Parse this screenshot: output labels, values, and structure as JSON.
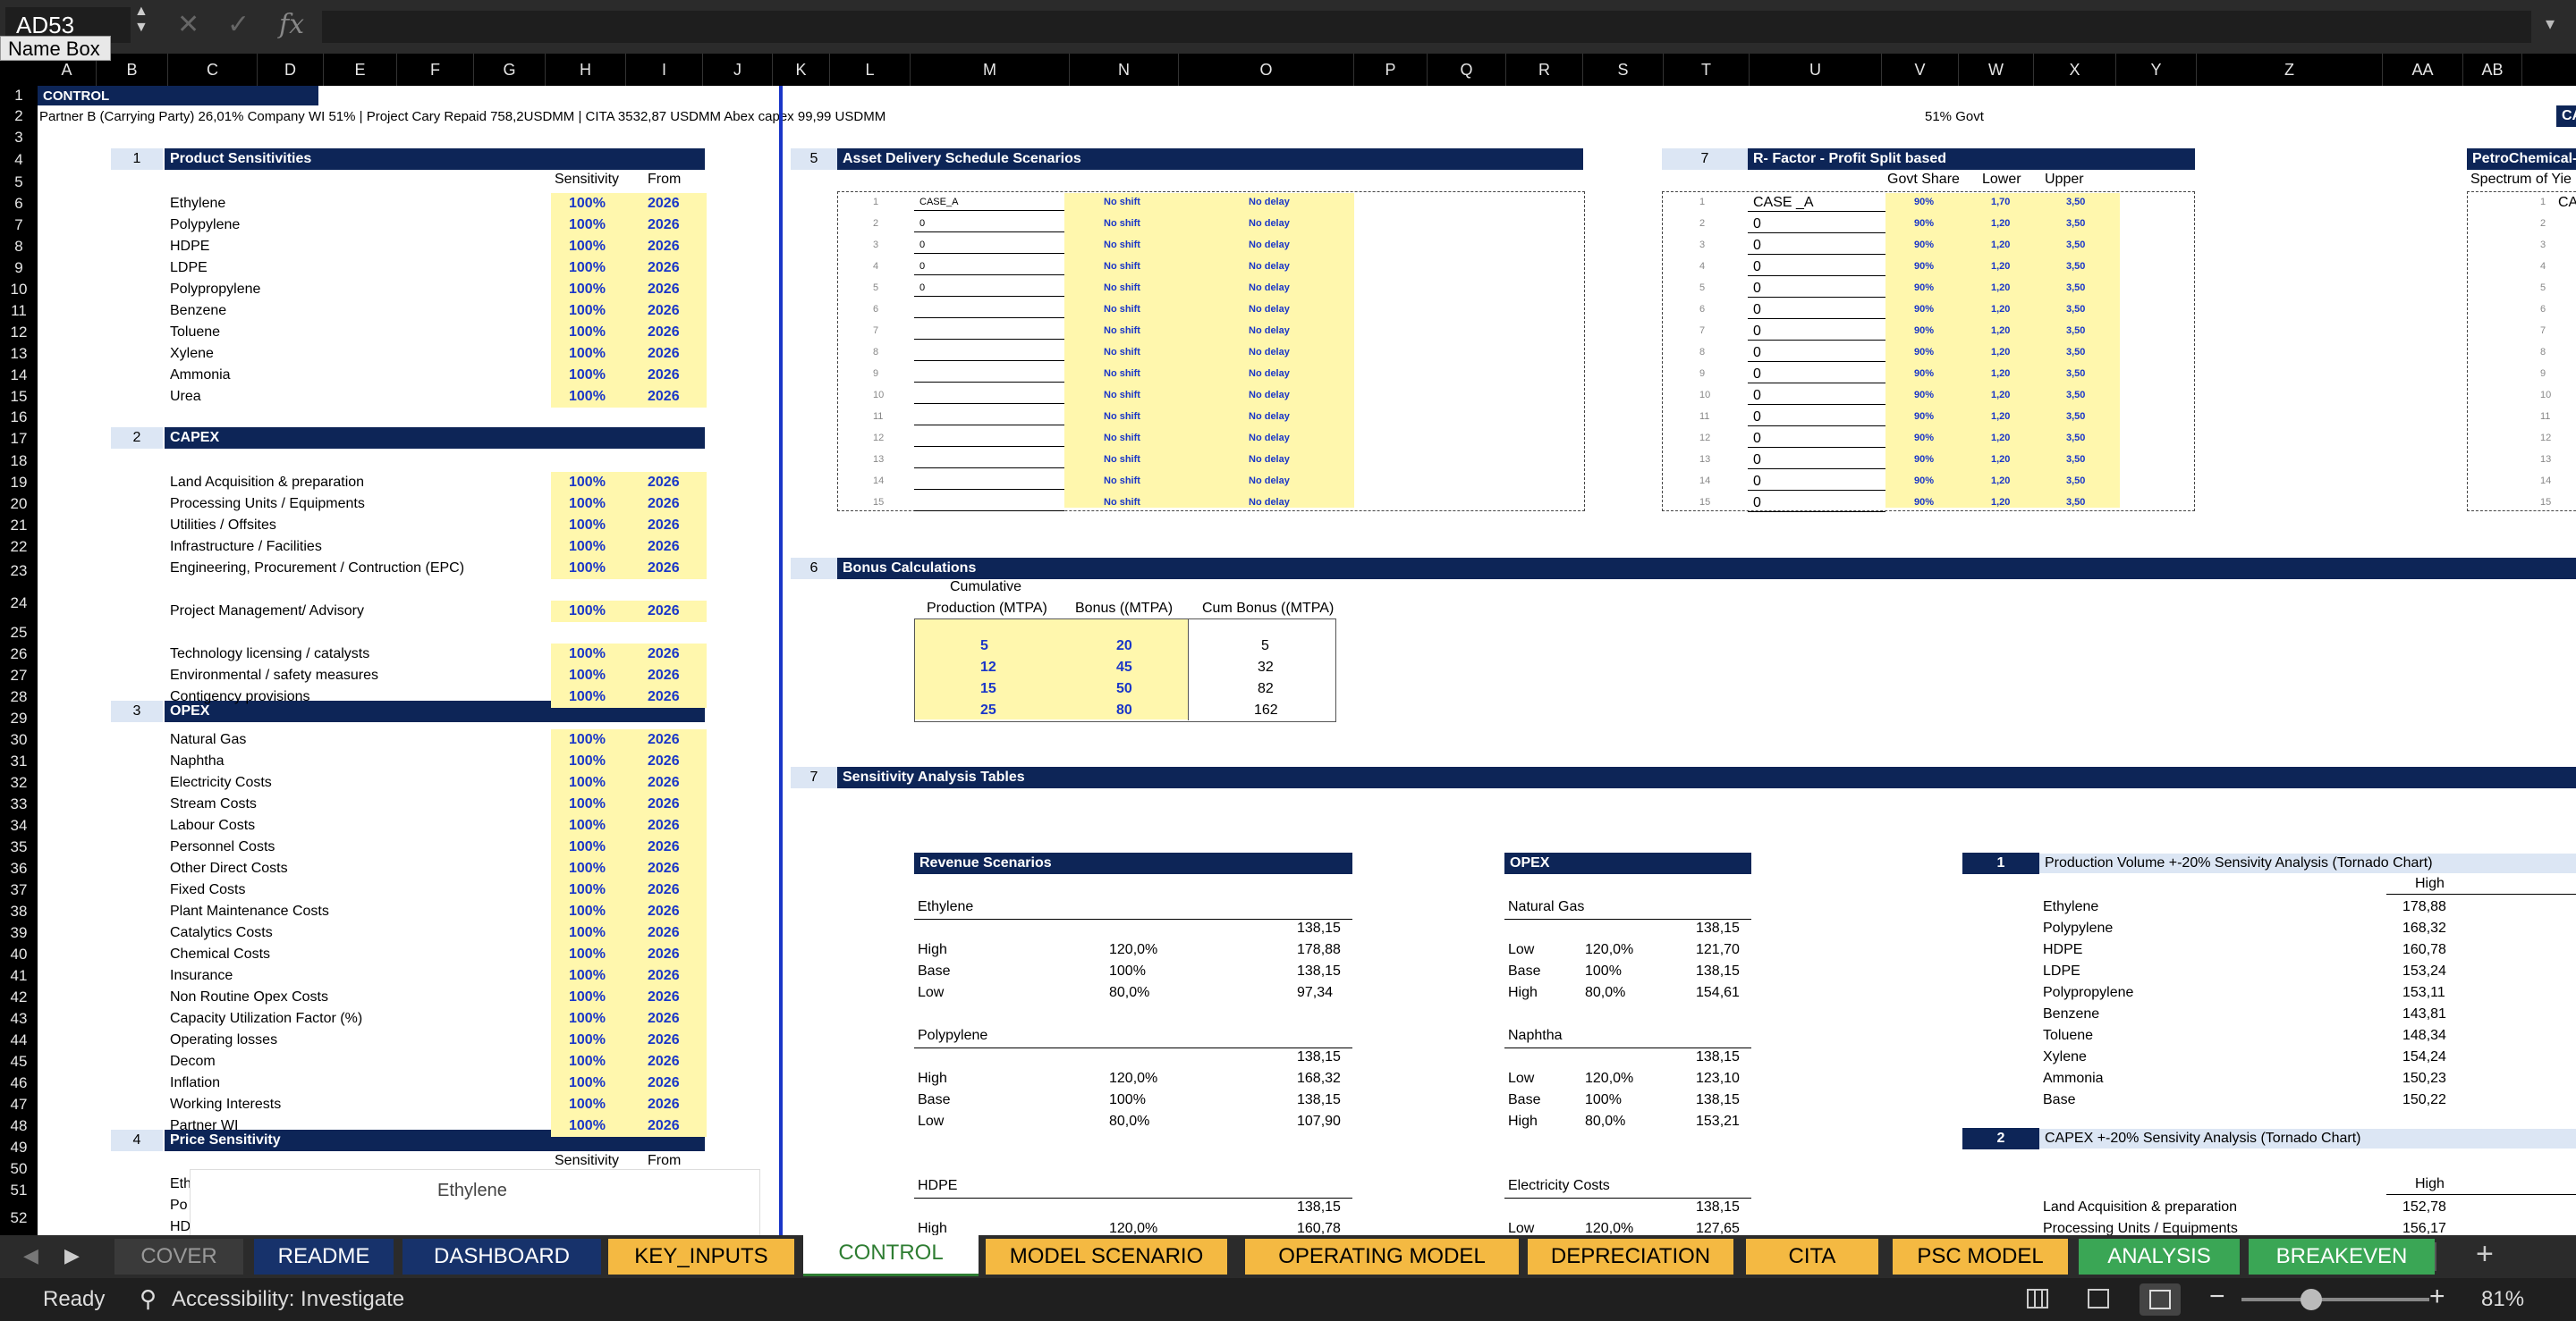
{
  "formula_bar": {
    "name_box": "AD53",
    "name_box_tooltip": "Name Box",
    "cancel_icon": "✕",
    "enter_icon": "✓",
    "fx": "fx"
  },
  "columns": [
    "A",
    "B",
    "C",
    "D",
    "E",
    "F",
    "G",
    "H",
    "I",
    "J",
    "K",
    "L",
    "M",
    "N",
    "O",
    "P",
    "Q",
    "R",
    "S",
    "T",
    "U",
    "V",
    "W",
    "X",
    "Y",
    "Z",
    "AA",
    "AB"
  ],
  "rows": [
    "1",
    "2",
    "3",
    "4",
    "5",
    "6",
    "7",
    "8",
    "9",
    "10",
    "11",
    "12",
    "13",
    "14",
    "15",
    "16",
    "17",
    "18",
    "19",
    "20",
    "21",
    "22",
    "23",
    "24",
    "25",
    "26",
    "27",
    "28",
    "29",
    "30",
    "31",
    "32",
    "33",
    "34",
    "35",
    "36",
    "37",
    "38",
    "39",
    "40",
    "41",
    "42",
    "43",
    "44",
    "45",
    "46",
    "47",
    "48",
    "49",
    "50",
    "51",
    "52"
  ],
  "sheet": {
    "control_title": "CONTROL",
    "row2_text": "Partner B (Carrying Party) 26,01% Company WI 51% |  Project Cary Repaid  758,2USDMM  |  CITA 3532,87  USDMM Abex capex 99,99  USDMM",
    "row2_right": "51%  Govt",
    "ca_fragment": "CA",
    "sections": {
      "s1": {
        "num": "1",
        "title": "Product Sensitivities",
        "col1": "Sensitivity",
        "col2": "From"
      },
      "s2": {
        "num": "2",
        "title": "CAPEX"
      },
      "s3": {
        "num": "3",
        "title": "OPEX"
      },
      "s4": {
        "num": "4",
        "title": "Price Sensitivity",
        "col1": "Sensitivity",
        "col2": "From"
      },
      "s5": {
        "num": "5",
        "title": "Asset Delivery Schedule  Scenarios"
      },
      "s6": {
        "num": "6",
        "title": "Bonus Calculations"
      },
      "s7a": {
        "num": "7",
        "title": "R- Factor - Profit Split based"
      },
      "s7b": {
        "num": "7",
        "title": "Sensitivity Analysis Tables"
      },
      "petro": {
        "title": "PetroChemical-",
        "sub": "Spectrum of Yie"
      }
    },
    "products": [
      "Ethylene",
      "Polypylene",
      "HDPE",
      "LDPE",
      "Polypropylene",
      "Benzene",
      "Toluene",
      "Xylene",
      "Ammonia",
      "Urea"
    ],
    "capex": [
      "Land Acquisition & preparation",
      "Processing Units /  Equipments",
      "Utilities  /  Offsites",
      "Infrastructure /  Facilities",
      "Engineering, Procurement / Contruction (EPC)",
      "Project Management/ Advisory",
      "Technology licensing  / catalysts",
      "Environmental / safety measures",
      "Contigency provisions"
    ],
    "opex": [
      "Natural Gas",
      "Naphtha",
      "Electricity Costs",
      "Stream Costs",
      "Labour Costs",
      "Personnel Costs",
      "Other Direct Costs",
      "Fixed Costs",
      "Plant Maintenance Costs",
      "Catalytics Costs",
      "Chemical Costs",
      "Insurance",
      "Non Routine Opex Costs",
      "Capacity Utilization Factor (%)",
      "Operating losses",
      "Decom",
      "Inflation",
      "Working Interests",
      "Partner WI"
    ],
    "sens_value": "100%",
    "from_value": "2026",
    "price_rows": [
      "Eth",
      "Po",
      "HD"
    ],
    "chart_stub": "Ethylene",
    "asset": {
      "case": "CASE_A",
      "case_rows": [
        "0",
        "0",
        "0",
        "0"
      ],
      "shift": "No shift",
      "delay": "No delay",
      "count": 15
    },
    "rfactor": {
      "headers": [
        "Govt Share",
        "Lower",
        "Upper"
      ],
      "case": "CASE _A",
      "zero": "0",
      "govt": "90%",
      "lower_first": "1,70",
      "lower": "1,20",
      "upper": "3,50"
    },
    "bonus": {
      "headers": [
        "Cumulative",
        "Production (MTPA)",
        "Bonus ((MTPA)",
        "Cum Bonus ((MTPA)"
      ],
      "rows": [
        [
          "5",
          "20",
          "5"
        ],
        [
          "12",
          "45",
          "32"
        ],
        [
          "15",
          "50",
          "82"
        ],
        [
          "25",
          "80",
          "162"
        ]
      ]
    },
    "revenue": {
      "title": "Revenue Scenarios",
      "groups": [
        {
          "name": "Ethylene",
          "top": "138,15",
          "rows": [
            [
              "High",
              "120,0%",
              "178,88"
            ],
            [
              "Base",
              "100%",
              "138,15"
            ],
            [
              "Low",
              "80,0%",
              "97,34"
            ]
          ]
        },
        {
          "name": "Polypylene",
          "top": "138,15",
          "rows": [
            [
              "High",
              "120,0%",
              "168,32"
            ],
            [
              "Base",
              "100%",
              "138,15"
            ],
            [
              "Low",
              "80,0%",
              "107,90"
            ]
          ]
        },
        {
          "name": "HDPE",
          "top": "138,15",
          "rows": [
            [
              "High",
              "120,0%",
              "160,78"
            ]
          ]
        }
      ]
    },
    "opex_table": {
      "title": "OPEX",
      "groups": [
        {
          "name": "Natural Gas",
          "top": "138,15",
          "rows": [
            [
              "Low",
              "120,0%",
              "121,70"
            ],
            [
              "Base",
              "100%",
              "138,15"
            ],
            [
              "High",
              "80,0%",
              "154,61"
            ]
          ]
        },
        {
          "name": "Naphtha",
          "top": "138,15",
          "rows": [
            [
              "Low",
              "120,0%",
              "123,10"
            ],
            [
              "Base",
              "100%",
              "138,15"
            ],
            [
              "High",
              "80,0%",
              "153,21"
            ]
          ]
        },
        {
          "name": "Electricity Costs",
          "top": "138,15",
          "rows": [
            [
              "Low",
              "120,0%",
              "127,65"
            ]
          ]
        }
      ]
    },
    "tornado": {
      "t1_num": "1",
      "t1_title": "Production Volume  +-20% Sensivity Analysis (Tornado Chart)",
      "high": "High",
      "t1_rows": [
        [
          "Ethylene",
          "178,88"
        ],
        [
          "Polypylene",
          "168,32"
        ],
        [
          "HDPE",
          "160,78"
        ],
        [
          "LDPE",
          "153,24"
        ],
        [
          "Polypropylene",
          "153,11"
        ],
        [
          "Benzene",
          "143,81"
        ],
        [
          "Toluene",
          "148,34"
        ],
        [
          "Xylene",
          "154,24"
        ],
        [
          "Ammonia",
          "150,23"
        ],
        [
          "Base",
          "150,22"
        ]
      ],
      "t2_num": "2",
      "t2_title": "CAPEX +-20% Sensivity Analysis (Tornado Chart)",
      "t2_rows": [
        [
          "Land Acquisition & preparation",
          "152,78"
        ],
        [
          "Processing Units /  Equipments",
          "156,17"
        ]
      ]
    }
  },
  "tabs": [
    "COVER",
    "README",
    "DASHBOARD",
    "KEY_INPUTS",
    "CONTROL",
    "MODEL SCENARIO",
    "OPERATING MODEL",
    "DEPRECIATION",
    "CITA",
    "PSC MODEL",
    "ANALYSIS",
    "BREAKEVEN"
  ],
  "status": {
    "ready": "Ready",
    "accessibility": "Accessibility: Investigate",
    "zoom": "81%"
  },
  "colors": {
    "header_navy": "#0d2557",
    "input_yellow": "#fff7ad",
    "tab_orange": "#f4b942",
    "tab_navy": "#17326b",
    "tab_green": "#3aa655"
  }
}
